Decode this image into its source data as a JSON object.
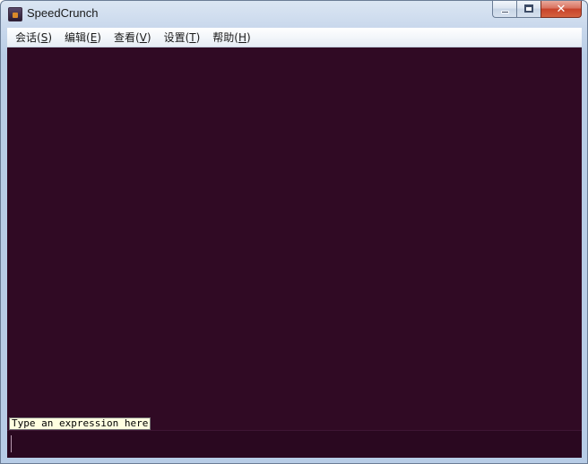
{
  "window": {
    "title": "SpeedCrunch",
    "icon": "speedcrunch-app-icon"
  },
  "window_controls": {
    "minimize": "minimize-icon",
    "maximize": "maximize-icon",
    "close_glyph": "✕"
  },
  "menu": {
    "items": [
      {
        "label": "会话(",
        "key": "S",
        "suffix": ")"
      },
      {
        "label": "编辑(",
        "key": "E",
        "suffix": ")"
      },
      {
        "label": "查看(",
        "key": "V",
        "suffix": ")"
      },
      {
        "label": "设置(",
        "key": "T",
        "suffix": ")"
      },
      {
        "label": "帮助(",
        "key": "H",
        "suffix": ")"
      }
    ]
  },
  "editor": {
    "hint": "Type an expression here",
    "value": ""
  },
  "colors": {
    "background": "#300a24",
    "hint_background": "#ffffe1"
  }
}
